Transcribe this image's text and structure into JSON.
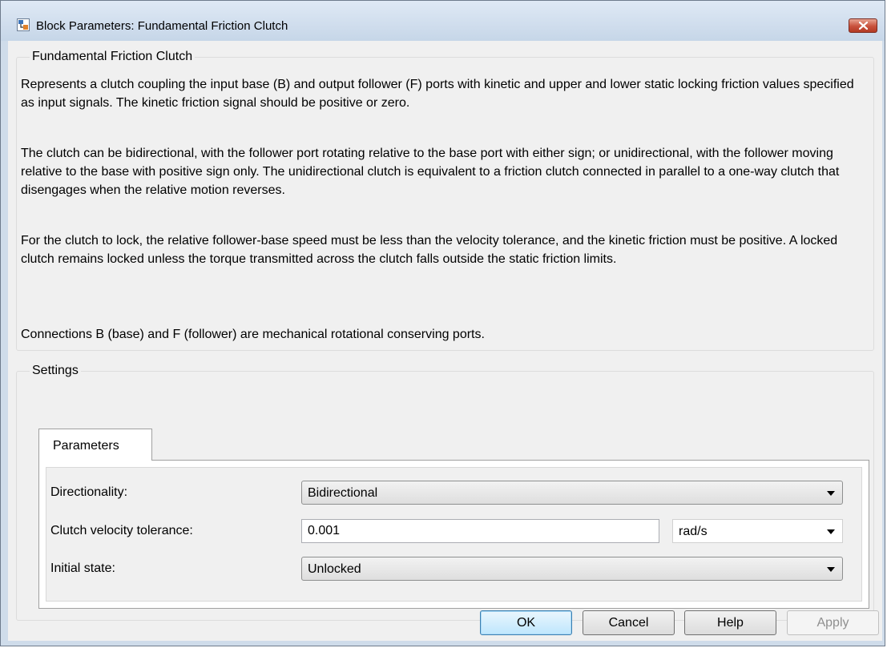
{
  "window": {
    "title": "Block Parameters: Fundamental Friction Clutch"
  },
  "description": {
    "group_title": "Fundamental Friction Clutch",
    "paragraphs": [
      "Represents a clutch coupling the input base (B) and output follower (F) ports with kinetic and upper and lower static locking friction values specified as input signals. The kinetic friction signal should be positive or zero.",
      "The clutch can be bidirectional, with the follower port rotating relative to the base port with either sign; or unidirectional, with the follower moving relative to the base with positive sign only. The unidirectional clutch is equivalent to a friction clutch connected in parallel to a one-way clutch that disengages when the relative motion reverses.",
      "For the clutch to lock, the relative follower-base speed must be less than the velocity tolerance, and the kinetic friction must be positive. A locked clutch remains locked unless the torque transmitted across the clutch falls outside the static friction limits.",
      "Connections B (base) and F (follower) are mechanical rotational conserving ports."
    ]
  },
  "settings": {
    "group_title": "Settings",
    "tab_label": "Parameters",
    "directionality": {
      "label": "Directionality:",
      "value": "Bidirectional"
    },
    "velocity_tolerance": {
      "label": "Clutch velocity tolerance:",
      "value": "0.001",
      "unit": "rad/s"
    },
    "initial_state": {
      "label": "Initial state:",
      "value": "Unlocked"
    }
  },
  "buttons": {
    "ok": "OK",
    "cancel": "Cancel",
    "help": "Help",
    "apply": "Apply"
  },
  "icons": {
    "app": "simulink-block-icon",
    "close": "close-icon",
    "dropdown": "chevron-down-icon"
  },
  "colors": {
    "close_button": "#c8513c",
    "default_button_border": "#3c7fb1",
    "dialog_background": "#f0f0f0",
    "frame": "#cfdcea"
  }
}
